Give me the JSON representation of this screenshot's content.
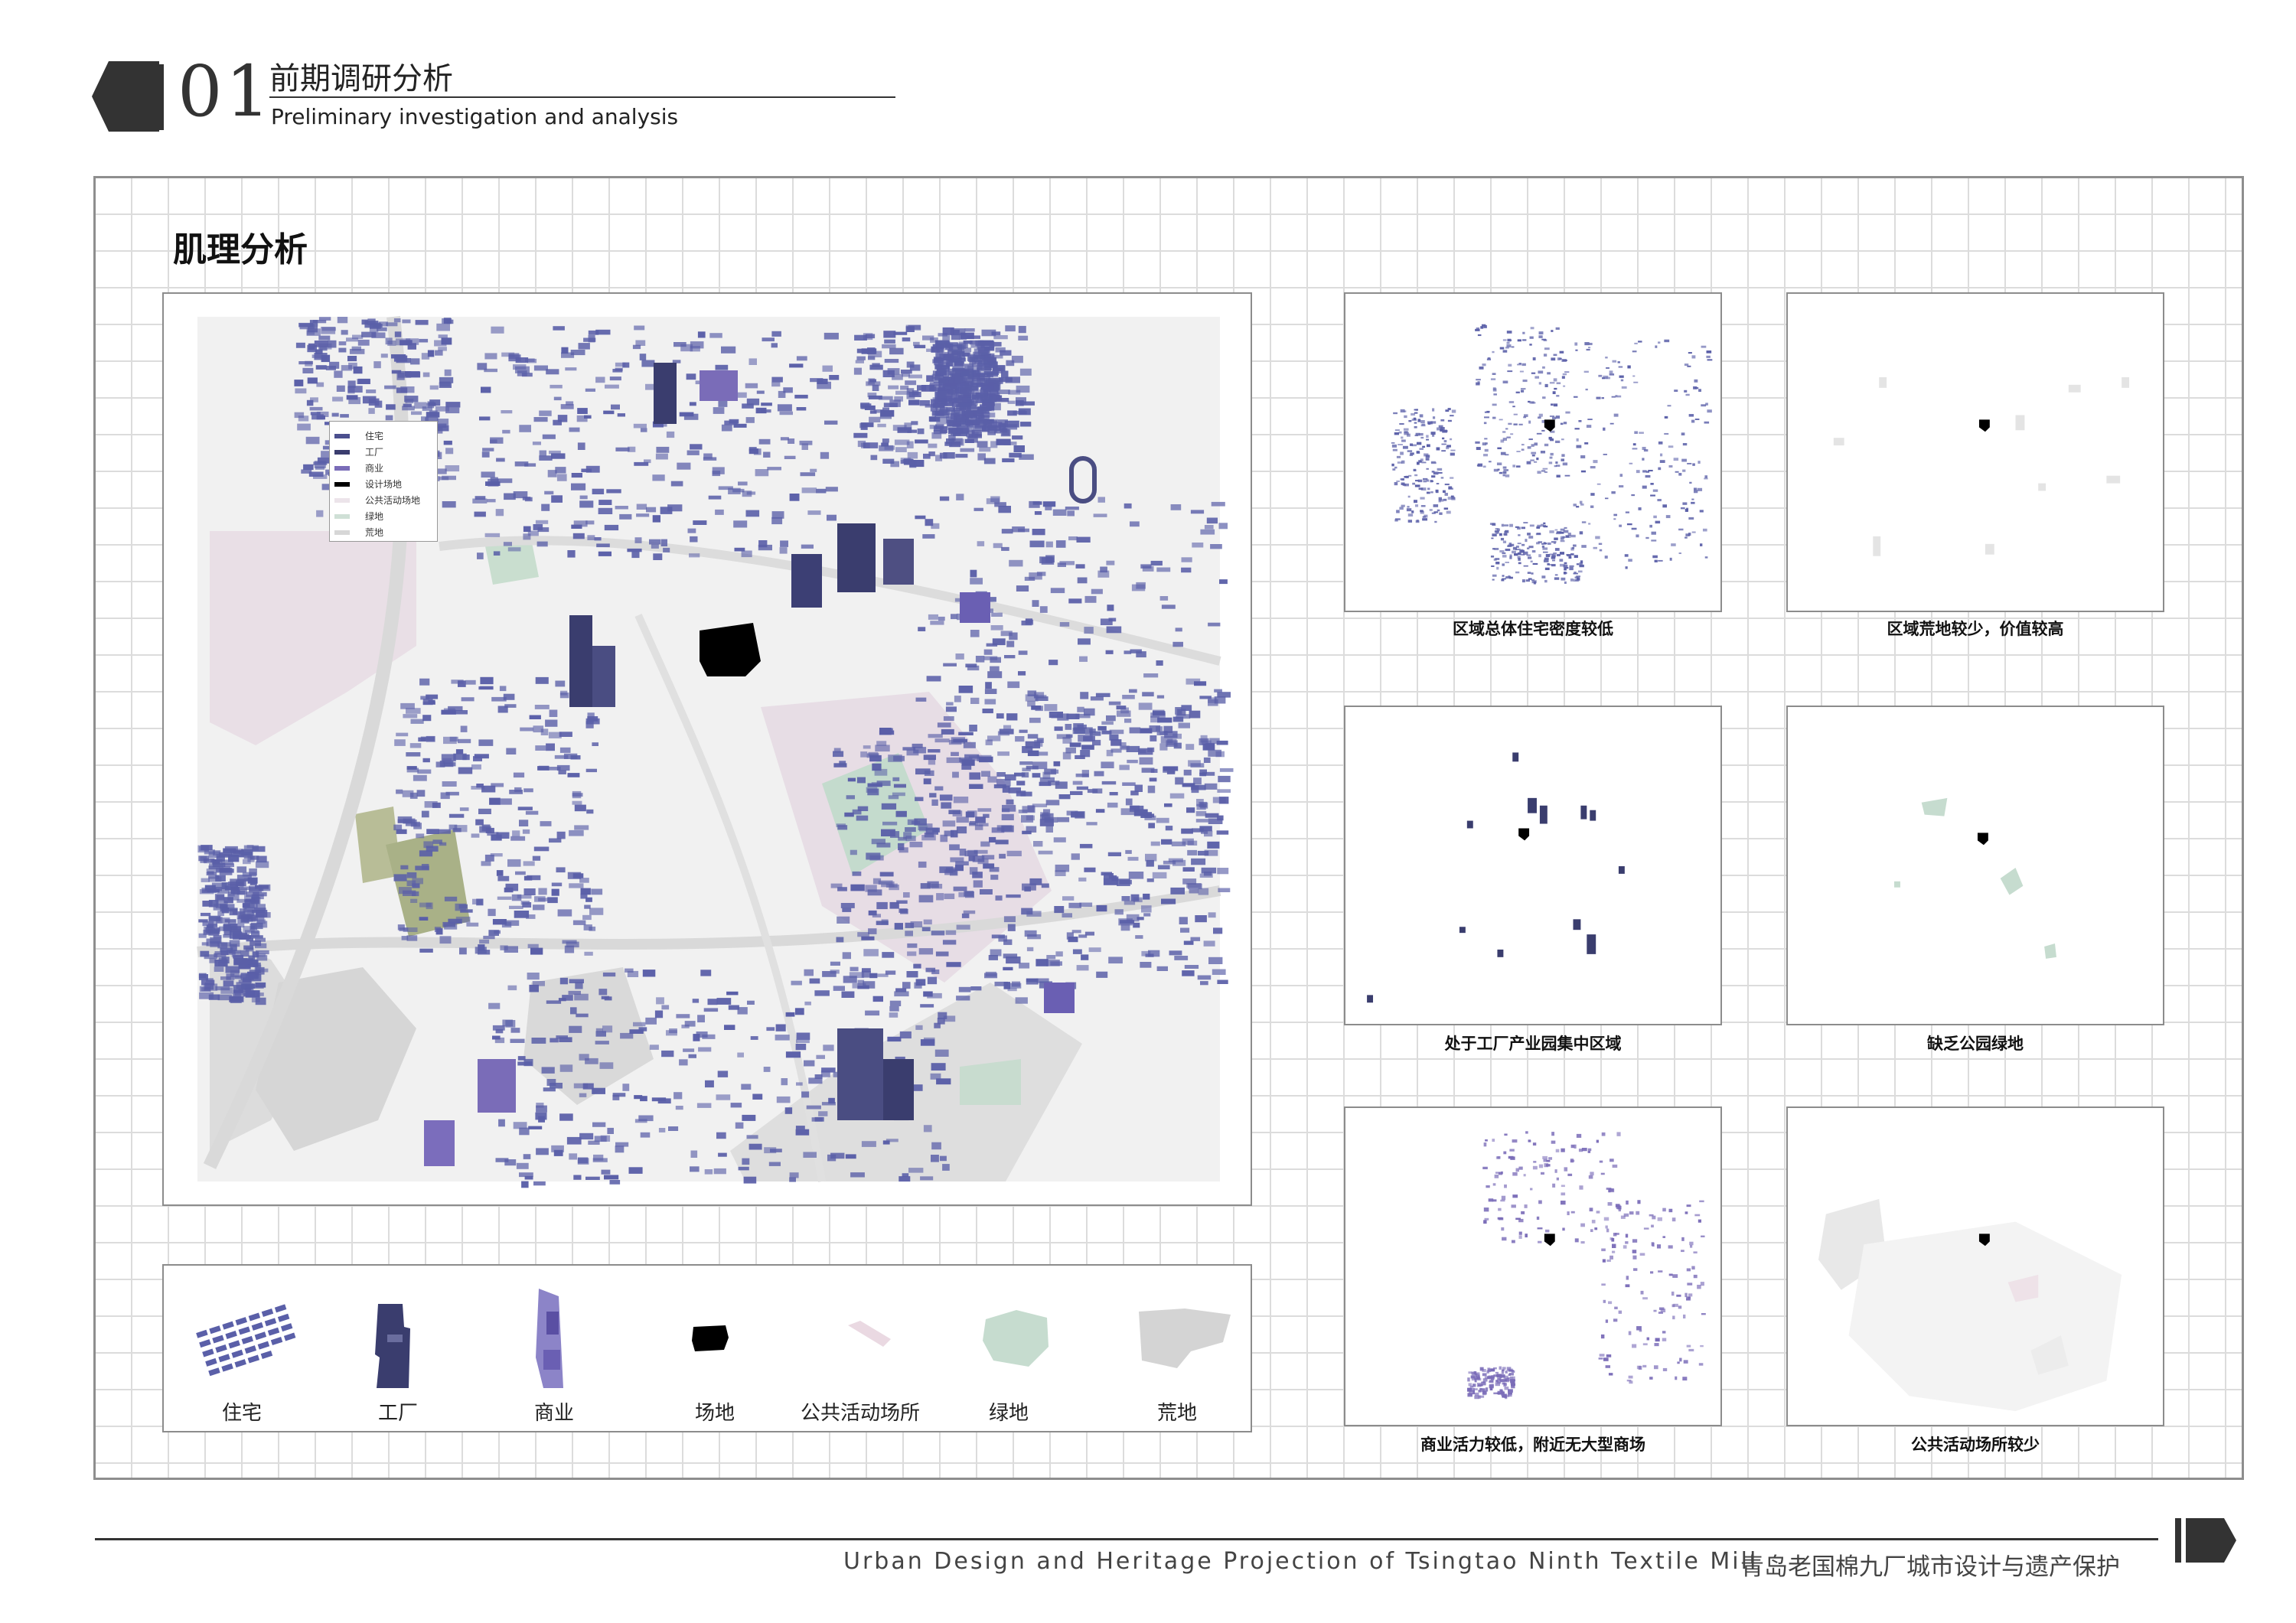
{
  "header": {
    "section_number": "01",
    "title_zh": "前期调研分析",
    "title_en": "Preliminary investigation and analysis"
  },
  "board": {
    "title": "肌理分析"
  },
  "map_legend": {
    "items": [
      {
        "label": "住宅",
        "color": "#4b4f8e"
      },
      {
        "label": "工厂",
        "color": "#3a3d6e"
      },
      {
        "label": "商业",
        "color": "#7a6cb8"
      },
      {
        "label": "设计场地",
        "color": "#000000"
      },
      {
        "label": "公共活动场地",
        "color": "#ece4ea"
      },
      {
        "label": "绿地",
        "color": "#cfe0d6"
      },
      {
        "label": "荒地",
        "color": "#d7d7d7"
      }
    ]
  },
  "legend_strip": {
    "items": [
      {
        "label": "住宅",
        "color": "#5a5fa8"
      },
      {
        "label": "工厂",
        "color": "#3a3d6e"
      },
      {
        "label": "商业",
        "color": "#7a6cb8"
      },
      {
        "label": "场地",
        "color": "#000000"
      },
      {
        "label": "公共活动场所",
        "color": "#ead9e2"
      },
      {
        "label": "绿地",
        "color": "#c6dccf"
      },
      {
        "label": "荒地",
        "color": "#d4d4d4"
      }
    ]
  },
  "mini_maps": [
    {
      "caption": "区域总体住宅密度较低"
    },
    {
      "caption": "区域荒地较少，价值较高"
    },
    {
      "caption": "处于工厂产业园集中区域"
    },
    {
      "caption": "缺乏公园绿地"
    },
    {
      "caption": "商业活力较低，附近无大型商场"
    },
    {
      "caption": "公共活动场所较少"
    }
  ],
  "footer": {
    "title_en": "Urban Design and Heritage Projection of Tsingtao Ninth Textile Mill",
    "title_zh": "青岛老国棉九厂城市设计与遗产保护"
  },
  "colors": {
    "residential": "#5a5fa8",
    "factory": "#3a3d6e",
    "commercial": "#7a6cb8",
    "site": "#000000",
    "public": "#ead9e2",
    "green": "#c6dccf",
    "wasteland": "#d4d4d4",
    "grid": "#dcdcdc"
  }
}
